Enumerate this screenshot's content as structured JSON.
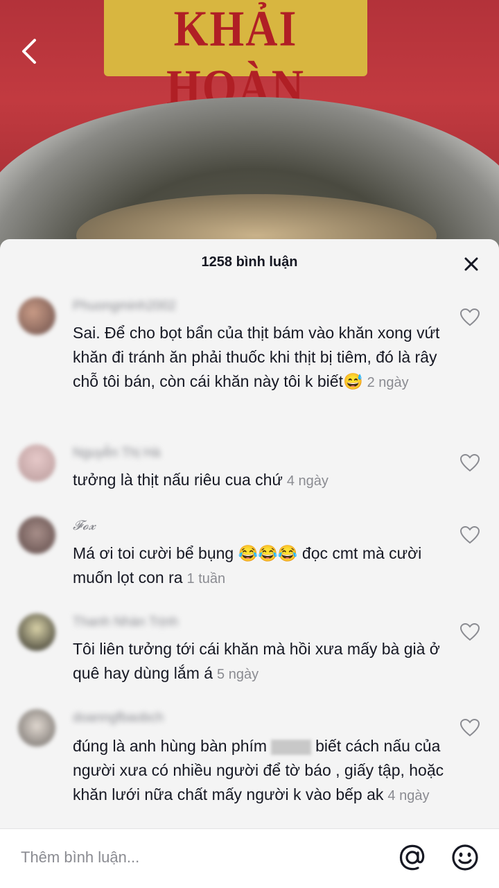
{
  "video": {
    "sign_text": "KHẢI HOÀN"
  },
  "panel": {
    "title": "1258 bình luận"
  },
  "comments": [
    {
      "username": "Phuongminh2002",
      "text": "Sai. Để cho bọt bẩn của thịt bám vào khăn xong vứt khăn đi tránh ăn phải thuốc khi thịt bị tiêm, đó là rây chỗ tôi bán, còn cái khăn này tôi k biết😅",
      "time": "2 ngày"
    },
    {
      "username": "Nguyễn Thị Hà",
      "text": "tưởng là thịt nấu riêu cua chứ",
      "time": "4 ngày"
    },
    {
      "username": "𝓕𝓸𝔁",
      "text": "Má ơi toi cười bể bụng 😂😂😂 đọc cmt mà cười muốn lọt con ra",
      "time": "1 tuần"
    },
    {
      "username": "Thanh Nhàn Trịnh",
      "text": "Tôi liên tưởng tới cái khăn mà hồi xưa mấy bà già ở quê hay dùng lắm á",
      "time": "5 ngày"
    },
    {
      "username": "doanngfbaobch",
      "text_before": "đúng là anh hùng bàn phím",
      "text_after": "biết cách nấu của người xưa có nhiều người để tờ báo , giấy tập, hoặc khăn lưới nữa chất mấy người k vào bếp ak",
      "time": "4 ngày"
    }
  ],
  "input": {
    "placeholder": "Thêm bình luận..."
  },
  "icons": {
    "back": "chevron-left-icon",
    "close": "close-icon",
    "like": "heart-outline-icon",
    "mention": "at-sign-icon",
    "emoji": "smiley-icon"
  },
  "colors": {
    "panel_bg": "#f4f4f4",
    "text": "#161823",
    "muted": "#8a8b91"
  }
}
